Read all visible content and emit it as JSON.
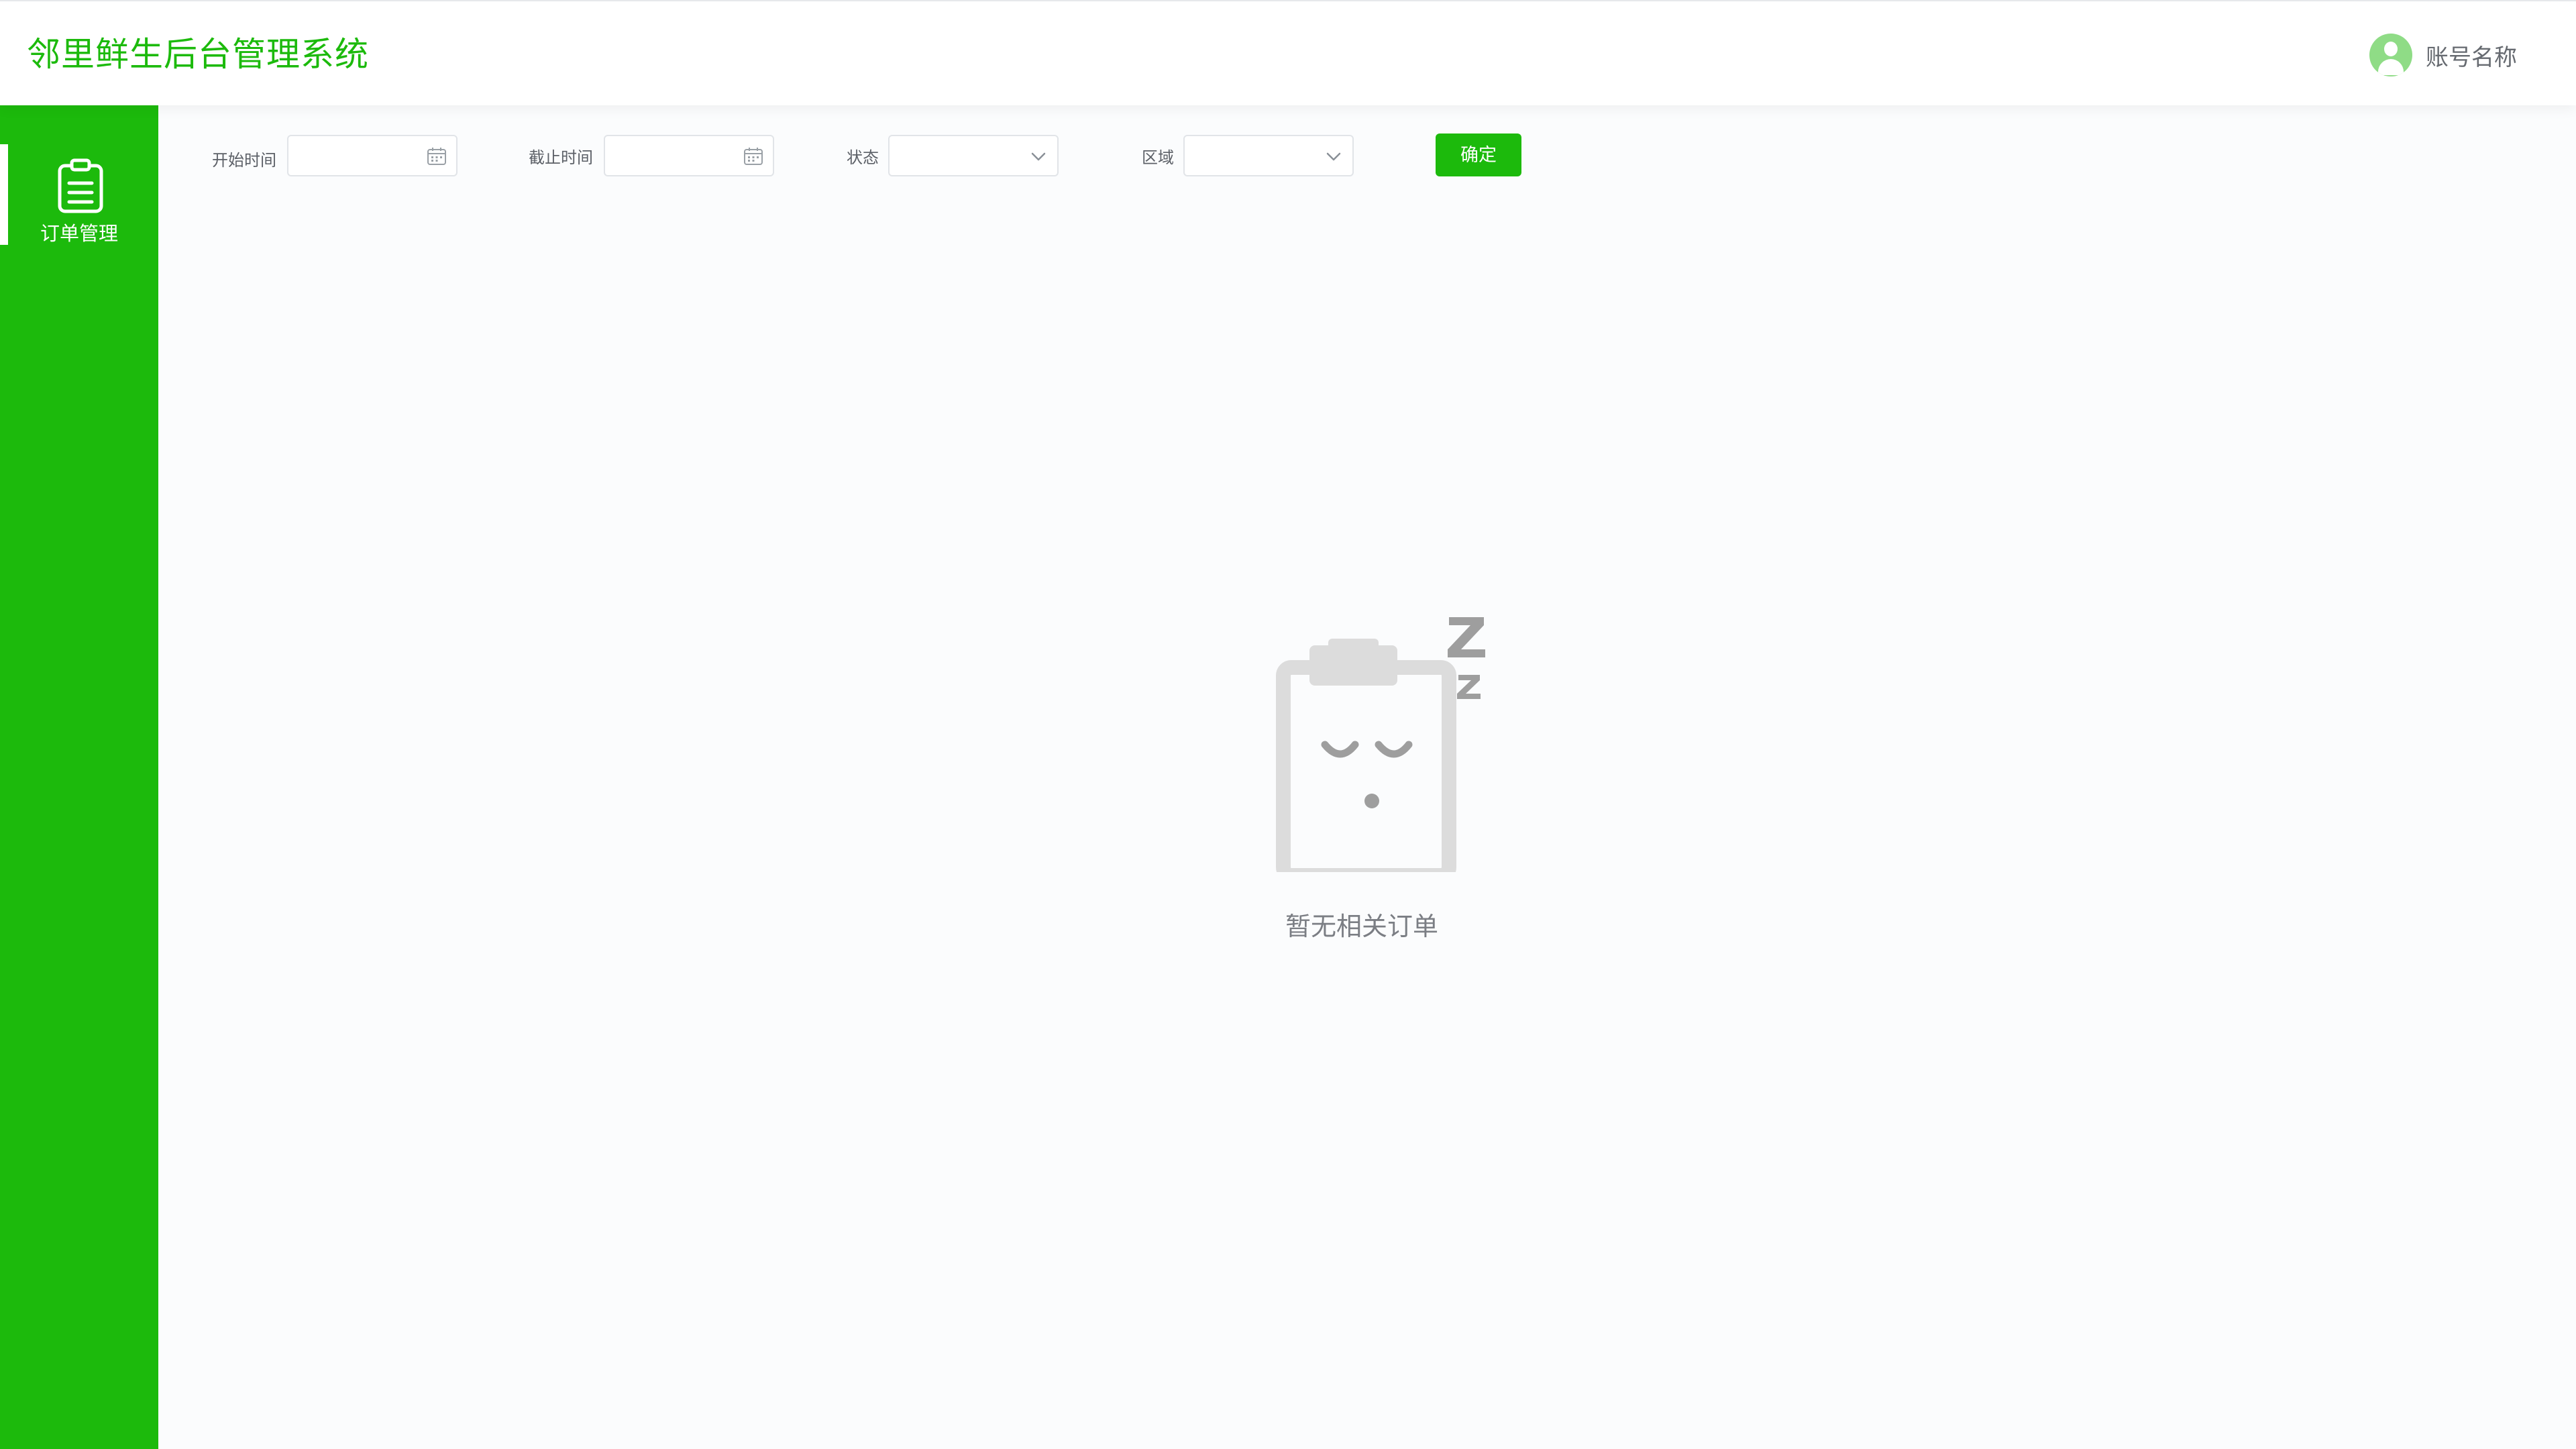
{
  "header": {
    "title": "邻里鲜生后台管理系统",
    "account_name": "账号名称"
  },
  "sidebar": {
    "items": [
      {
        "label": "订单管理",
        "icon": "clipboard-icon",
        "active": true
      }
    ]
  },
  "filters": {
    "start_time": {
      "label": "开始时间",
      "value": "",
      "placeholder": ""
    },
    "end_time": {
      "label": "截止时间",
      "value": "",
      "placeholder": ""
    },
    "status": {
      "label": "状态",
      "value": ""
    },
    "region": {
      "label": "区域",
      "value": ""
    },
    "confirm_label": "确定"
  },
  "empty_state": {
    "text": "暂无相关订单",
    "icon": "sleeping-clipboard-icon"
  },
  "colors": {
    "brand": "#1cba0c",
    "avatar": "#8fdc86",
    "background": "#fbfcfd"
  }
}
